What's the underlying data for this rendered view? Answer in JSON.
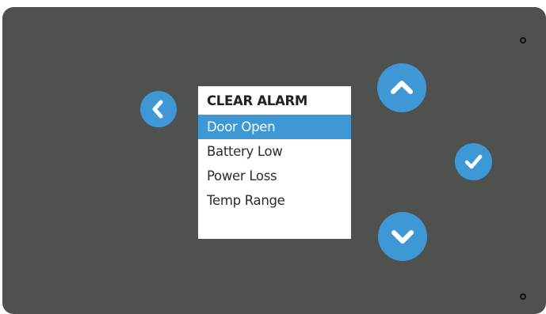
{
  "colors": {
    "device_body": "#4f514f",
    "button_accent": "#3f98d6",
    "selection_highlight": "#3f98d6",
    "screen_background": "#ffffff"
  },
  "icons": {
    "back": "chevron-left-icon",
    "up": "chevron-up-icon",
    "down": "chevron-down-icon",
    "ok": "checkmark-icon"
  },
  "screen": {
    "title": "CLEAR ALARM",
    "selected_index": 0,
    "items": [
      {
        "label": "Door Open"
      },
      {
        "label": "Battery Low"
      },
      {
        "label": "Power Loss"
      },
      {
        "label": "Temp Range"
      }
    ]
  }
}
